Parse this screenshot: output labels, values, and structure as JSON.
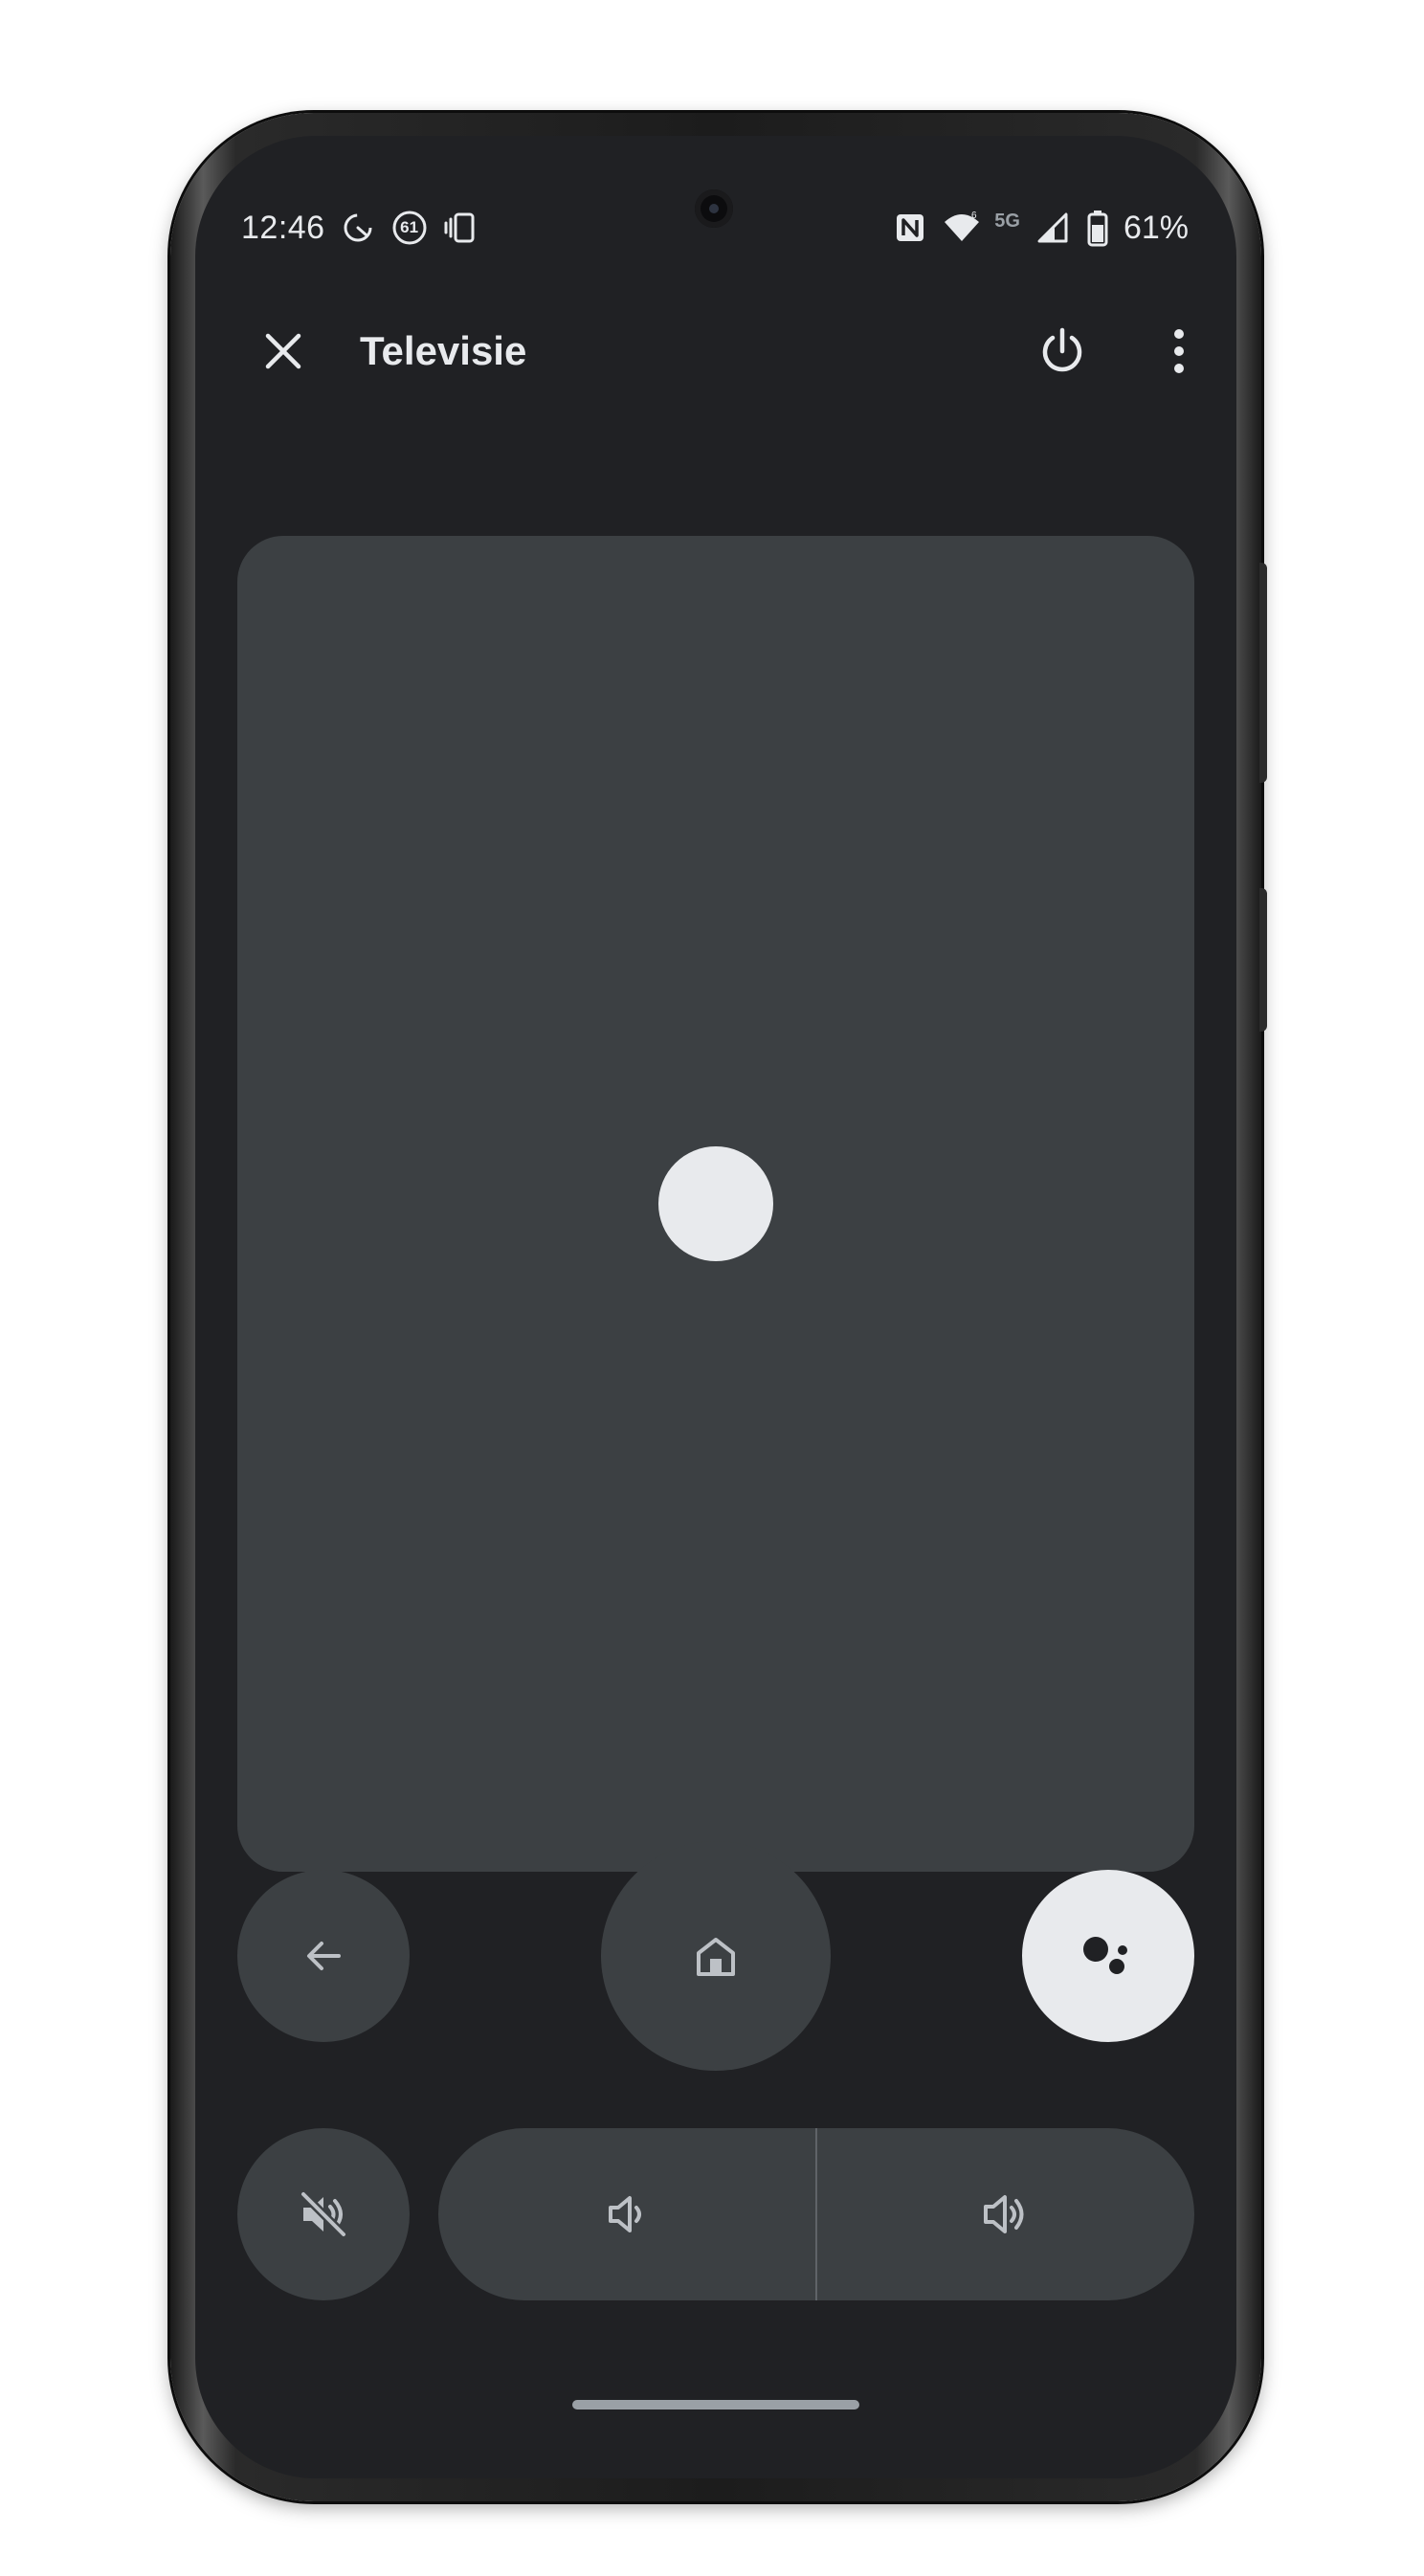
{
  "status_bar": {
    "time": "12:46",
    "notification_badge": "61",
    "network_label": "5G",
    "battery_percent": "61%",
    "icons": [
      "notification-swirl-icon",
      "badge-61-icon",
      "screen-rotate-icon",
      "nfc-icon",
      "wifi-icon",
      "signal-icon",
      "battery-icon"
    ]
  },
  "app_bar": {
    "title": "Televisie",
    "close_icon": "close-icon",
    "power_icon": "power-icon",
    "more_icon": "more-vert-icon"
  },
  "remote": {
    "touchpad": "touchpad",
    "buttons": [
      "back-arrow-icon",
      "home-icon",
      "assistant-icon",
      "volume-mute-icon",
      "volume-down-icon",
      "volume-up-icon"
    ]
  },
  "colors": {
    "background": "#202124",
    "surface": "#3c4043",
    "on_surface": "#e8eaed",
    "accent_highlight": "#e8eaed"
  }
}
